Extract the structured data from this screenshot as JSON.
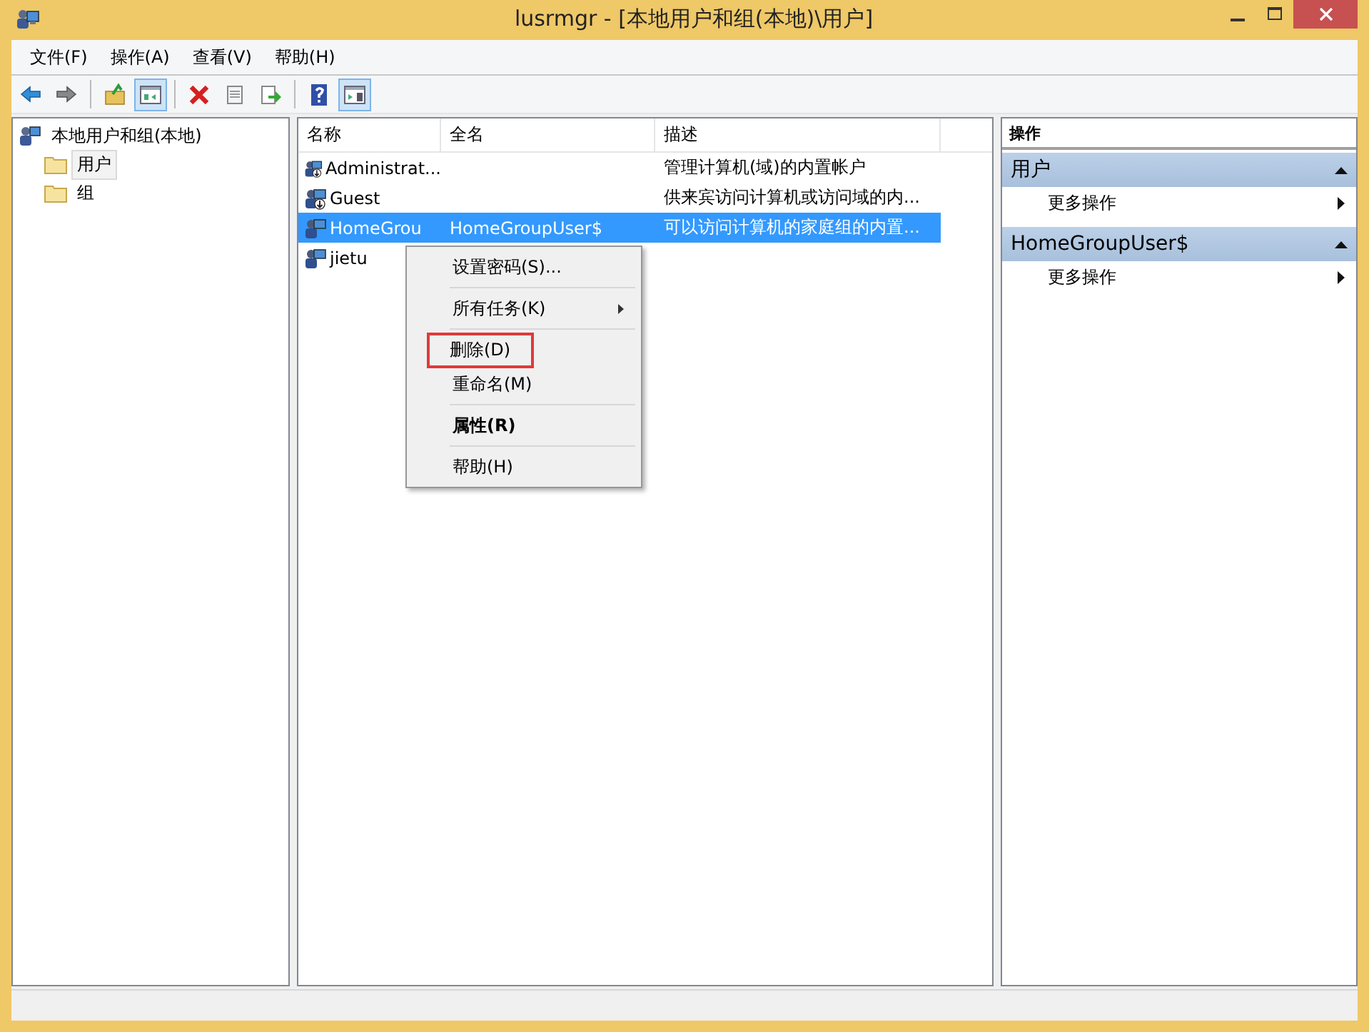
{
  "window": {
    "title": "lusrmgr - [本地用户和组(本地)\\用户]"
  },
  "menu": [
    "文件(F)",
    "操作(A)",
    "查看(V)",
    "帮助(H)"
  ],
  "toolbar": [
    {
      "kind": "back",
      "pressed": false
    },
    {
      "kind": "forward",
      "pressed": false
    },
    {
      "kind": "sep"
    },
    {
      "kind": "up",
      "pressed": false
    },
    {
      "kind": "tree",
      "pressed": true
    },
    {
      "kind": "sep"
    },
    {
      "kind": "delete",
      "pressed": false
    },
    {
      "kind": "properties",
      "pressed": false
    },
    {
      "kind": "export",
      "pressed": false
    },
    {
      "kind": "sep"
    },
    {
      "kind": "help",
      "pressed": false
    },
    {
      "kind": "actionpane",
      "pressed": true
    }
  ],
  "tree": {
    "label": "本地用户和组(本地)",
    "children": [
      {
        "label": "用户",
        "selected": true
      },
      {
        "label": "组",
        "selected": false
      }
    ]
  },
  "table": {
    "columns": [
      "名称",
      "全名",
      "描述"
    ],
    "rows": [
      {
        "name": "Administrat...",
        "full_name": "",
        "description": "管理计算机(域)的内置帐户",
        "kind": "builtin",
        "selected": false
      },
      {
        "name": "Guest",
        "full_name": "",
        "description": "供来宾访问计算机或访问域的内...",
        "kind": "builtin",
        "selected": false
      },
      {
        "name": "HomeGrou",
        "full_name": "HomeGroupUser$",
        "description": "可以访问计算机的家庭组的内置...",
        "kind": "user",
        "selected": true
      },
      {
        "name": "jietu",
        "full_name": "",
        "description": "",
        "kind": "user",
        "selected": false
      }
    ]
  },
  "context_menu": [
    {
      "label": "设置密码(S)...",
      "kind": "item",
      "bold": false,
      "highlighted": false
    },
    {
      "kind": "sep"
    },
    {
      "label": "所有任务(K)",
      "kind": "submenu",
      "bold": false,
      "highlighted": false
    },
    {
      "kind": "sep"
    },
    {
      "label": "删除(D)",
      "kind": "item",
      "bold": false,
      "highlighted": true
    },
    {
      "label": "重命名(M)",
      "kind": "item",
      "bold": false,
      "highlighted": false
    },
    {
      "kind": "sep"
    },
    {
      "label": "属性(R)",
      "kind": "item",
      "bold": true,
      "highlighted": false
    },
    {
      "kind": "sep"
    },
    {
      "label": "帮助(H)",
      "kind": "item",
      "bold": false,
      "highlighted": false
    }
  ],
  "actions": {
    "title": "操作",
    "sections": [
      {
        "title": "用户",
        "expanded": true,
        "items": [
          "更多操作"
        ]
      },
      {
        "title": "HomeGroupUser$",
        "expanded": true,
        "items": [
          "更多操作"
        ]
      }
    ]
  }
}
